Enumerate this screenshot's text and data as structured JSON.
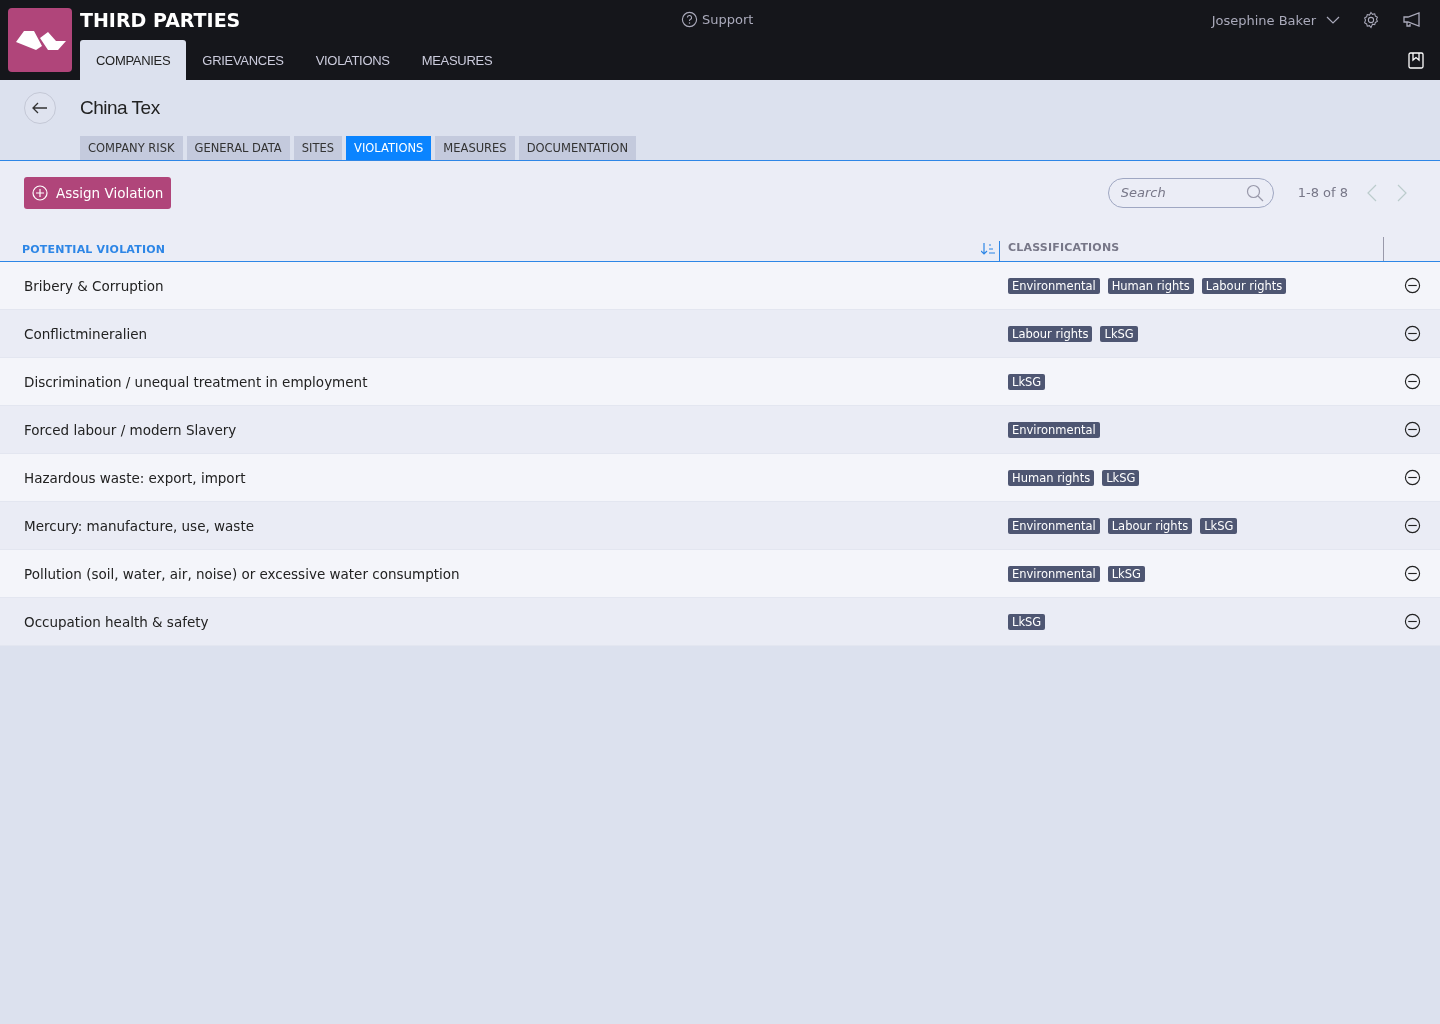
{
  "app": {
    "title": "THIRD PARTIES",
    "support": "Support",
    "user": "Josephine Baker"
  },
  "nav_tabs": [
    {
      "label": "COMPANIES",
      "selected": true
    },
    {
      "label": "GRIEVANCES",
      "selected": false
    },
    {
      "label": "VIOLATIONS",
      "selected": false
    },
    {
      "label": "MEASURES",
      "selected": false
    }
  ],
  "page": {
    "title": "China Tex"
  },
  "sub_tabs": [
    {
      "label": "COMPANY RISK",
      "selected": false
    },
    {
      "label": "GENERAL DATA",
      "selected": false
    },
    {
      "label": "SITES",
      "selected": false
    },
    {
      "label": "VIOLATIONS",
      "selected": true
    },
    {
      "label": "MEASURES",
      "selected": false
    },
    {
      "label": "DOCUMENTATION",
      "selected": false
    }
  ],
  "toolbar": {
    "button": "Assign Violation",
    "search": {
      "placeholder": "Search"
    },
    "pagination": "1-8 of 8"
  },
  "table": {
    "columns": [
      {
        "label": "POTENTIAL VIOLATION",
        "sorted": true
      },
      {
        "label": "CLASSIFICATIONS",
        "sorted": false
      }
    ],
    "rows": [
      {
        "name": "Bribery & Corruption",
        "tags": [
          "Environmental",
          "Human rights",
          "Labour rights"
        ]
      },
      {
        "name": "Conflictmineralien",
        "tags": [
          "Labour rights",
          "LkSG"
        ]
      },
      {
        "name": "Discrimination / unequal treatment in employment",
        "tags": [
          "LkSG"
        ]
      },
      {
        "name": "Forced labour / modern Slavery",
        "tags": [
          "Environmental"
        ]
      },
      {
        "name": "Hazardous waste: export, import",
        "tags": [
          "Human rights",
          "LkSG"
        ]
      },
      {
        "name": "Mercury: manufacture, use, waste",
        "tags": [
          "Environmental",
          "Labour rights",
          "LkSG"
        ]
      },
      {
        "name": "Pollution (soil, water, air, noise) or excessive water consumption",
        "tags": [
          "Environmental",
          "LkSG"
        ]
      },
      {
        "name": "Occupation health & safety",
        "tags": [
          "LkSG"
        ]
      }
    ]
  }
}
